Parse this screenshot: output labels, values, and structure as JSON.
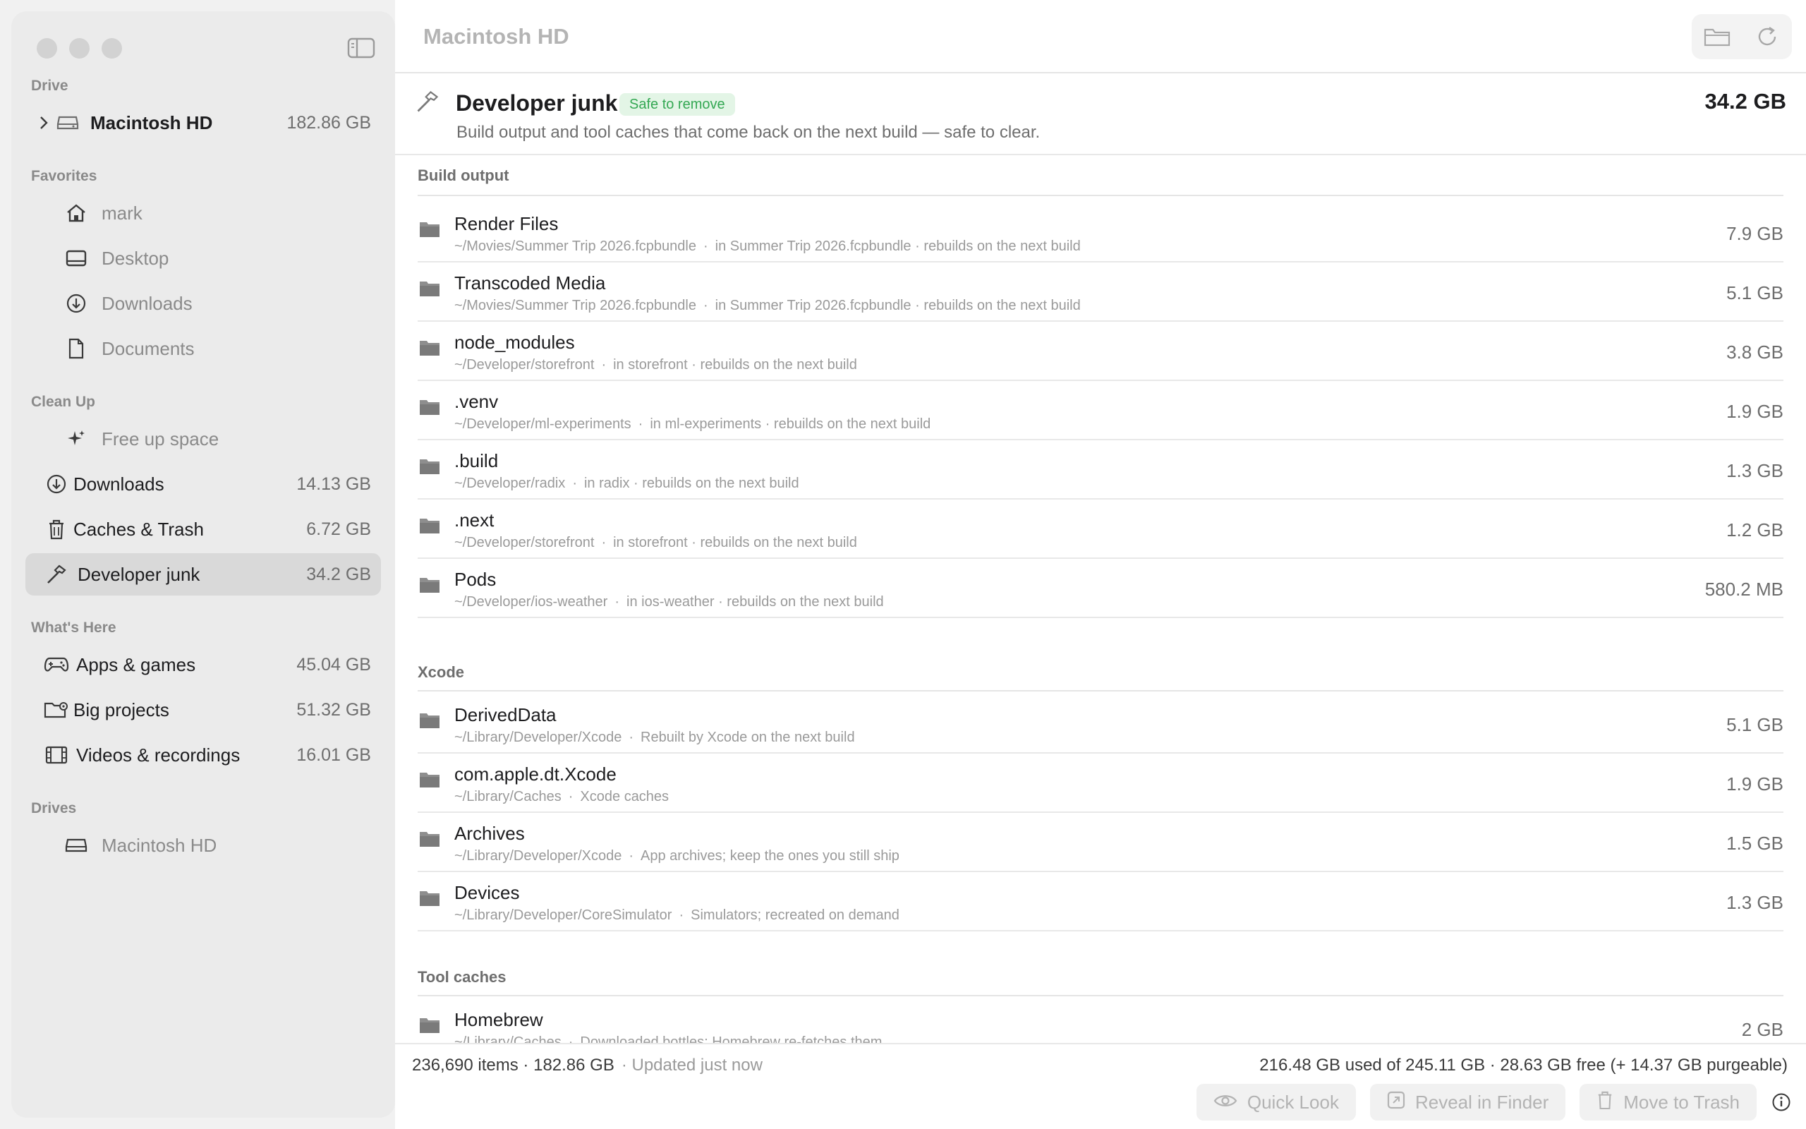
{
  "sidebar": {
    "drive_section": "Drive",
    "drive_item": {
      "label": "Macintosh HD",
      "size": "182.86 GB"
    },
    "favorites_section": "Favorites",
    "favorites": [
      {
        "label": "mark",
        "icon": "house-icon"
      },
      {
        "label": "Desktop",
        "icon": "desktop-icon"
      },
      {
        "label": "Downloads",
        "icon": "download-icon"
      },
      {
        "label": "Documents",
        "icon": "document-icon"
      }
    ],
    "cleanup_section": "Clean Up",
    "cleanup": [
      {
        "label": "Free up space",
        "icon": "sparkles-icon"
      },
      {
        "label": "Downloads",
        "size": "14.13 GB",
        "icon": "download-icon"
      },
      {
        "label": "Caches & Trash",
        "size": "6.72 GB",
        "icon": "trash-icon"
      },
      {
        "label": "Developer junk",
        "size": "34.2 GB",
        "icon": "hammer-icon"
      }
    ],
    "whats_here_section": "What's Here",
    "whats_here": [
      {
        "label": "Apps & games",
        "size": "45.04 GB",
        "icon": "gamecontroller-icon"
      },
      {
        "label": "Big projects",
        "size": "51.32 GB",
        "icon": "folder-gear-icon"
      },
      {
        "label": "Videos & recordings",
        "size": "16.01 GB",
        "icon": "film-icon"
      }
    ],
    "drives_section": "Drives",
    "drives": [
      {
        "label": "Macintosh HD",
        "icon": "drive-icon"
      }
    ]
  },
  "toolbar": {
    "title": "Macintosh HD"
  },
  "category": {
    "name": "Developer junk",
    "badge": "Safe to remove",
    "description": "Build output and tool caches that come back on the next build — safe to clear.",
    "total": "34.2 GB"
  },
  "groups": {
    "build_output": {
      "label": "Build output",
      "rows": [
        {
          "name": "Render Files",
          "path": "~/Movies/Summer Trip 2026.fcpbundle",
          "note": "in Summer Trip 2026.fcpbundle · rebuilds on the next build",
          "size": "7.9 GB"
        },
        {
          "name": "Transcoded Media",
          "path": "~/Movies/Summer Trip 2026.fcpbundle",
          "note": "in Summer Trip 2026.fcpbundle · rebuilds on the next build",
          "size": "5.1 GB"
        },
        {
          "name": "node_modules",
          "path": "~/Developer/storefront",
          "note": "in storefront · rebuilds on the next build",
          "size": "3.8 GB"
        },
        {
          "name": ".venv",
          "path": "~/Developer/ml-experiments",
          "note": "in ml-experiments · rebuilds on the next build",
          "size": "1.9 GB"
        },
        {
          "name": ".build",
          "path": "~/Developer/radix",
          "note": "in radix · rebuilds on the next build",
          "size": "1.3 GB"
        },
        {
          "name": ".next",
          "path": "~/Developer/storefront",
          "note": "in storefront · rebuilds on the next build",
          "size": "1.2 GB"
        },
        {
          "name": "Pods",
          "path": "~/Developer/ios-weather",
          "note": "in ios-weather · rebuilds on the next build",
          "size": "580.2 MB"
        }
      ]
    },
    "xcode": {
      "label": "Xcode",
      "rows": [
        {
          "name": "DerivedData",
          "path": "~/Library/Developer/Xcode",
          "note": "Rebuilt by Xcode on the next build",
          "size": "5.1 GB"
        },
        {
          "name": "com.apple.dt.Xcode",
          "path": "~/Library/Caches",
          "note": "Xcode caches",
          "size": "1.9 GB"
        },
        {
          "name": "Archives",
          "path": "~/Library/Developer/Xcode",
          "note": "App archives; keep the ones you still ship",
          "size": "1.5 GB"
        },
        {
          "name": "Devices",
          "path": "~/Library/Developer/CoreSimulator",
          "note": "Simulators; recreated on demand",
          "size": "1.3 GB"
        }
      ]
    },
    "tool_caches": {
      "label": "Tool caches",
      "rows": [
        {
          "name": "Homebrew",
          "path": "~/Library/Caches",
          "note": "Downloaded bottles; Homebrew re-fetches them",
          "size": "2 GB"
        }
      ]
    }
  },
  "path_separator": "·",
  "status": {
    "summary": "236,690 items · 182.86 GB",
    "updated": "· Updated just now",
    "disk": "216.48 GB used of 245.11 GB · 28.63 GB free (+ 14.37 GB purgeable)"
  },
  "actions": {
    "quick_look": "Quick Look",
    "reveal": "Reveal in Finder",
    "trash": "Move to Trash"
  },
  "colors": {
    "badge_bg": "#e3f5e6",
    "badge_text": "#34a853",
    "active_item": "#d9d9d9"
  }
}
